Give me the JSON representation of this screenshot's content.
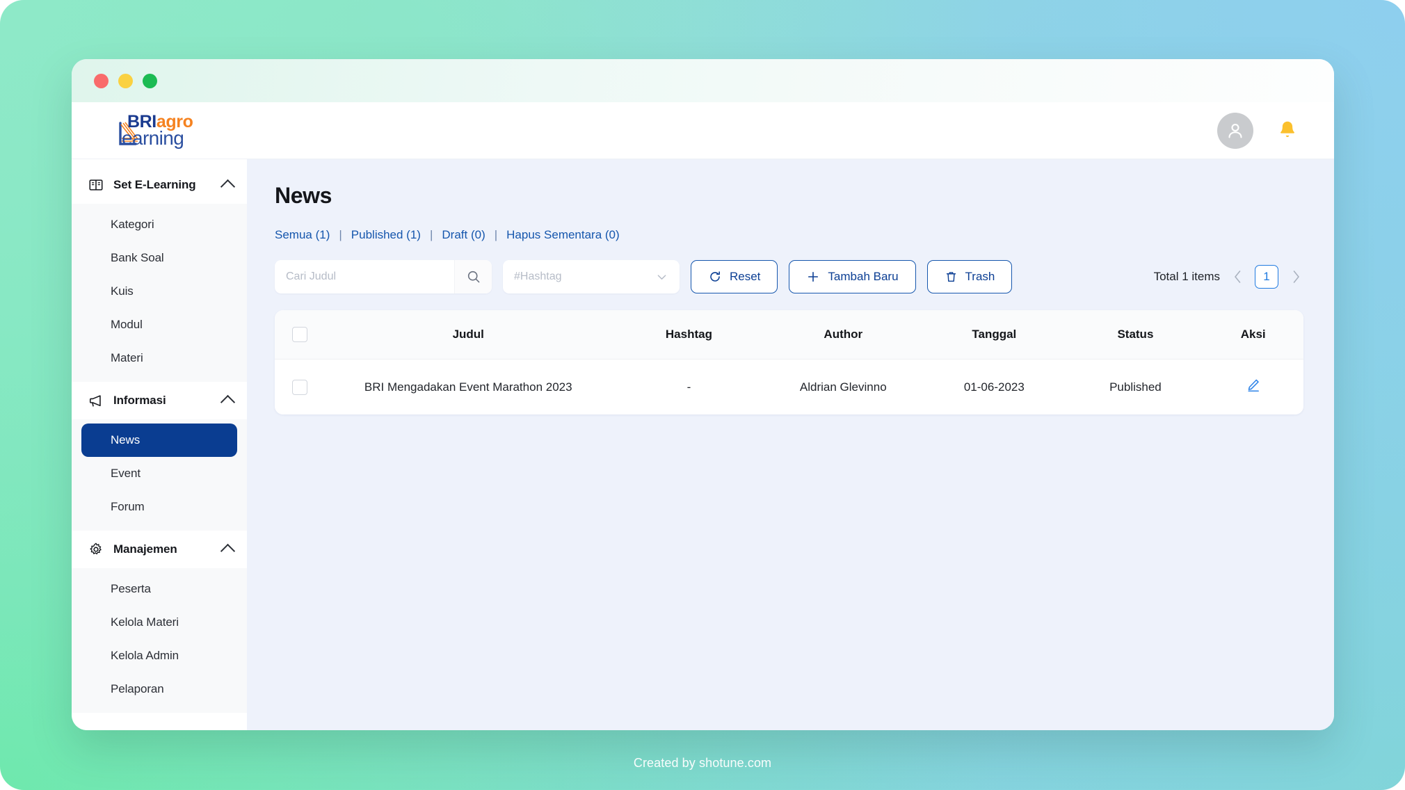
{
  "window": {
    "traffic_lights": [
      "close",
      "minimize",
      "maximize"
    ]
  },
  "brand": {
    "line1_bold": "BRI",
    "line1_accent": "agro",
    "line2": "earning",
    "color_primary": "#1a3a8f",
    "color_accent": "#f58220"
  },
  "header": {
    "avatar_icon": "user-icon",
    "notification_icon": "bell-icon",
    "bell_color": "#fbc02d"
  },
  "sidebar": {
    "groups": [
      {
        "title": "Set E-Learning",
        "icon": "book-icon",
        "chevron": "chevron-up-icon",
        "items": [
          {
            "label": "Kategori",
            "active": false
          },
          {
            "label": "Bank Soal",
            "active": false
          },
          {
            "label": "Kuis",
            "active": false
          },
          {
            "label": "Modul",
            "active": false
          },
          {
            "label": "Materi",
            "active": false
          }
        ]
      },
      {
        "title": "Informasi",
        "icon": "megaphone-icon",
        "chevron": "chevron-up-icon",
        "items": [
          {
            "label": "News",
            "active": true
          },
          {
            "label": "Event",
            "active": false
          },
          {
            "label": "Forum",
            "active": false
          }
        ]
      },
      {
        "title": "Manajemen",
        "icon": "gear-icon",
        "chevron": "chevron-up-icon",
        "items": [
          {
            "label": "Peserta",
            "active": false
          },
          {
            "label": "Kelola Materi",
            "active": false
          },
          {
            "label": "Kelola Admin",
            "active": false
          },
          {
            "label": "Pelaporan",
            "active": false
          }
        ]
      }
    ],
    "active_color": "#0a3d91"
  },
  "main": {
    "page_title": "News",
    "filters": [
      {
        "label": "Semua (1)"
      },
      {
        "label": "Published (1)"
      },
      {
        "label": "Draft (0)"
      },
      {
        "label": "Hapus Sementara (0)"
      }
    ],
    "filter_separator": "|",
    "filter_color": "#1556ad",
    "search": {
      "placeholder": "Cari Judul",
      "value": "",
      "icon": "search-icon"
    },
    "hashtag": {
      "placeholder": "#Hashtag",
      "value": "",
      "icon": "chevron-down-icon"
    },
    "buttons": [
      {
        "label": "Reset",
        "icon": "refresh-icon"
      },
      {
        "label": "Tambah Baru",
        "icon": "plus-icon"
      },
      {
        "label": "Trash",
        "icon": "trash-icon"
      }
    ],
    "pagination": {
      "total_text": "Total 1 items",
      "prev_icon": "chevron-left-icon",
      "next_icon": "chevron-right-icon",
      "current_page": "1"
    },
    "table": {
      "columns": [
        "",
        "Judul",
        "Hashtag",
        "Author",
        "Tanggal",
        "Status",
        "Aksi"
      ],
      "rows": [
        {
          "judul": "BRI Mengadakan Event Marathon 2023",
          "hashtag": "-",
          "author": "Aldrian Glevinno",
          "tanggal": "01-06-2023",
          "status": "Published",
          "aksi_icon": "edit-pencil-icon"
        }
      ]
    }
  },
  "footer": {
    "text": "Created by shotune.com"
  }
}
